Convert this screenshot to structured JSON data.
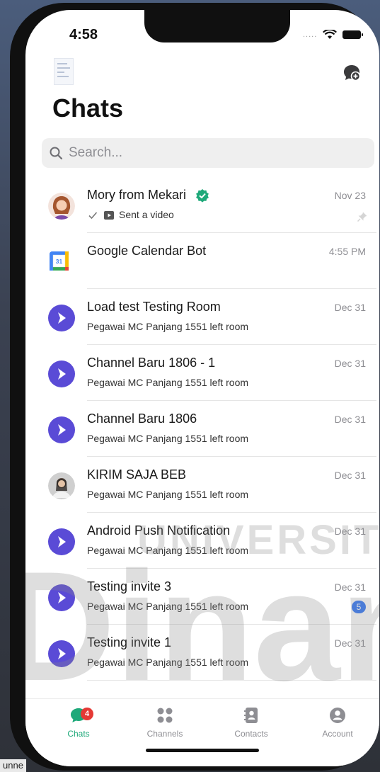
{
  "status_bar": {
    "time": "4:58",
    "signal": "....."
  },
  "header": {
    "title": "Chats"
  },
  "search": {
    "placeholder": "Search..."
  },
  "chats": [
    {
      "title": "Mory from Mekari",
      "subtitle": "Sent a video",
      "time": "Nov 23",
      "avatar": "person-illustration",
      "verified": true,
      "pinned": true,
      "read_receipt": true
    },
    {
      "title": "Google Calendar Bot",
      "subtitle": "",
      "time": "4:55 PM",
      "avatar": "google-calendar-icon"
    },
    {
      "title": "Load test Testing Room",
      "subtitle": "Pegawai MC Panjang 1551 left room",
      "time": "Dec 31",
      "avatar": "brand-logo"
    },
    {
      "title": "Channel Baru 1806 - 1",
      "subtitle": "Pegawai MC Panjang 1551 left room",
      "time": "Dec 31",
      "avatar": "brand-logo"
    },
    {
      "title": "Channel Baru 1806",
      "subtitle": "Pegawai MC Panjang 1551 left room",
      "time": "Dec 31",
      "avatar": "brand-logo"
    },
    {
      "title": "KIRIM SAJA BEB",
      "subtitle": "Pegawai MC Panjang 1551 left room",
      "time": "Dec 31",
      "avatar": "photo"
    },
    {
      "title": "Android Push Notification",
      "subtitle": "Pegawai MC Panjang 1551 left room",
      "time": "Dec 31",
      "avatar": "brand-logo"
    },
    {
      "title": "Testing invite 3",
      "subtitle": "Pegawai MC Panjang 1551 left room",
      "time": "Dec 31",
      "avatar": "brand-logo",
      "unread": "5"
    },
    {
      "title": "Testing invite 1",
      "subtitle": "Pegawai MC Panjang 1551 left room",
      "time": "Dec 31",
      "avatar": "brand-logo"
    }
  ],
  "tabs": [
    {
      "label": "Chats",
      "icon": "chat-bubble-icon",
      "badge": "4",
      "active": true
    },
    {
      "label": "Channels",
      "icon": "grid-dots-icon"
    },
    {
      "label": "Contacts",
      "icon": "contact-book-icon"
    },
    {
      "label": "Account",
      "icon": "user-circle-icon"
    }
  ],
  "watermark": {
    "text_top": "UNIVERSITA",
    "text_big": "Dinan"
  },
  "caption": {
    "text": "unne"
  },
  "colors": {
    "accent": "#1fa97a",
    "brand": "#5a4bd6",
    "badge_red": "#e53935",
    "badge_blue": "#3478f6",
    "verified": "#1fa97a"
  }
}
